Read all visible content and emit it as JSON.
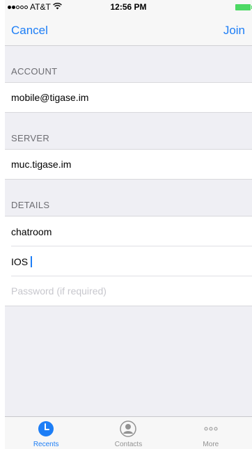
{
  "status_bar": {
    "carrier": "AT&T",
    "wifi_icon": "wifi-icon",
    "time": "12:56 PM",
    "battery_color": "#4cd964"
  },
  "nav": {
    "cancel_label": "Cancel",
    "join_label": "Join"
  },
  "sections": {
    "account": {
      "header": "ACCOUNT",
      "value": "mobile@tigase.im"
    },
    "server": {
      "header": "SERVER",
      "value": "muc.tigase.im"
    },
    "details": {
      "header": "DETAILS",
      "room": "chatroom",
      "nickname": "IOS",
      "password_placeholder": "Password (if required)"
    }
  },
  "tabbar": {
    "tabs": [
      {
        "label": "Recents",
        "icon": "clock-icon",
        "active": true
      },
      {
        "label": "Contacts",
        "icon": "person-icon",
        "active": false
      },
      {
        "label": "More",
        "icon": "more-dots-icon",
        "active": false
      }
    ]
  },
  "colors": {
    "accent": "#1d7ef6",
    "background": "#efeff4",
    "placeholder": "#c7c7cd"
  }
}
